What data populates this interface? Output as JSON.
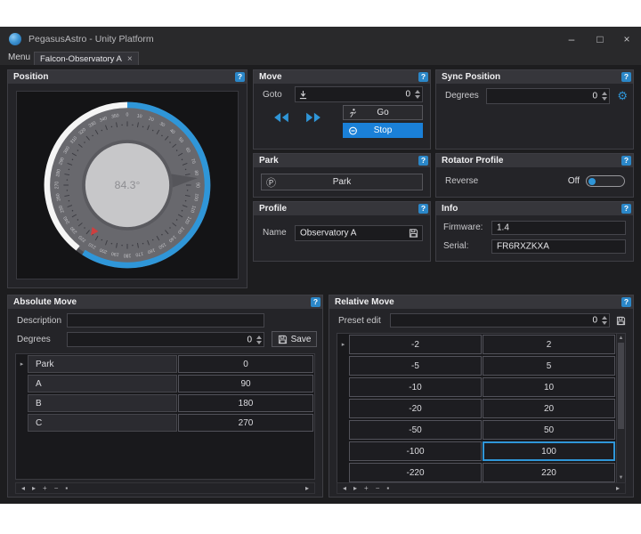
{
  "window": {
    "title": "PegasusAstro - Unity Platform",
    "controls": {
      "minimize": "–",
      "maximize": "□",
      "close": "×"
    }
  },
  "tabs": {
    "menu_label": "Menu",
    "active_tab": "Falcon-Observatory A",
    "close_glyph": "×"
  },
  "help_glyph": "?",
  "row_indicator": "▸",
  "navigator": {
    "items": [
      "◂",
      "▸",
      "+",
      "−",
      "▪"
    ],
    "end_glyph": "▸"
  },
  "scrollbar": {
    "up": "▲",
    "down": "▼"
  },
  "icons": {
    "gear": "⚙",
    "park": "Ⓟ"
  },
  "colors": {
    "accent": "#2f96d8",
    "stop_button": "#1a80d8",
    "dial_blue": "#2f96d8",
    "dial_white": "#f5f5f5",
    "red_marker": "#cf3f3f"
  },
  "panels": {
    "position": {
      "title": "Position",
      "dial": {
        "center_label": "84.3°",
        "value_deg": 84.3,
        "blue_arc": [
          0,
          213
        ],
        "white_arc": [
          218,
          360
        ],
        "red_marker_deg": 216,
        "tick_step_deg": 10,
        "tick_labels_start": 0,
        "tick_labels_end": 350
      }
    },
    "move": {
      "title": "Move",
      "goto_label": "Goto",
      "goto_value": "0",
      "go_label": "Go",
      "stop_label": "Stop"
    },
    "sync_position": {
      "title": "Sync Position",
      "degrees_label": "Degrees",
      "degrees_value": "0"
    },
    "park": {
      "title": "Park",
      "park_button_label": "Park"
    },
    "rotator_profile": {
      "title": "Rotator Profile",
      "reverse_label": "Reverse",
      "reverse_state": "Off"
    },
    "profile": {
      "title": "Profile",
      "name_label": "Name",
      "name_value": "Observatory A"
    },
    "info": {
      "title": "Info",
      "firmware_label": "Firmware:",
      "firmware_value": "1.4",
      "serial_label": "Serial:",
      "serial_value": "FR6RXZKXA"
    },
    "absolute_move": {
      "title": "Absolute Move",
      "description_label": "Description",
      "description_value": "",
      "degrees_label": "Degrees",
      "degrees_value": "0",
      "save_label": "Save",
      "presets": [
        {
          "name": "Park",
          "value": "0"
        },
        {
          "name": "A",
          "value": "90"
        },
        {
          "name": "B",
          "value": "180"
        },
        {
          "name": "C",
          "value": "270"
        }
      ]
    },
    "relative_move": {
      "title": "Relative Move",
      "preset_label": "Preset edit",
      "preset_value": "0",
      "rows": [
        [
          "-2",
          "2"
        ],
        [
          "-5",
          "5"
        ],
        [
          "-10",
          "10"
        ],
        [
          "-20",
          "20"
        ],
        [
          "-50",
          "50"
        ],
        [
          "-100",
          "100"
        ],
        [
          "-220",
          "220"
        ]
      ],
      "selected": {
        "row": 5,
        "col": 1
      }
    }
  }
}
